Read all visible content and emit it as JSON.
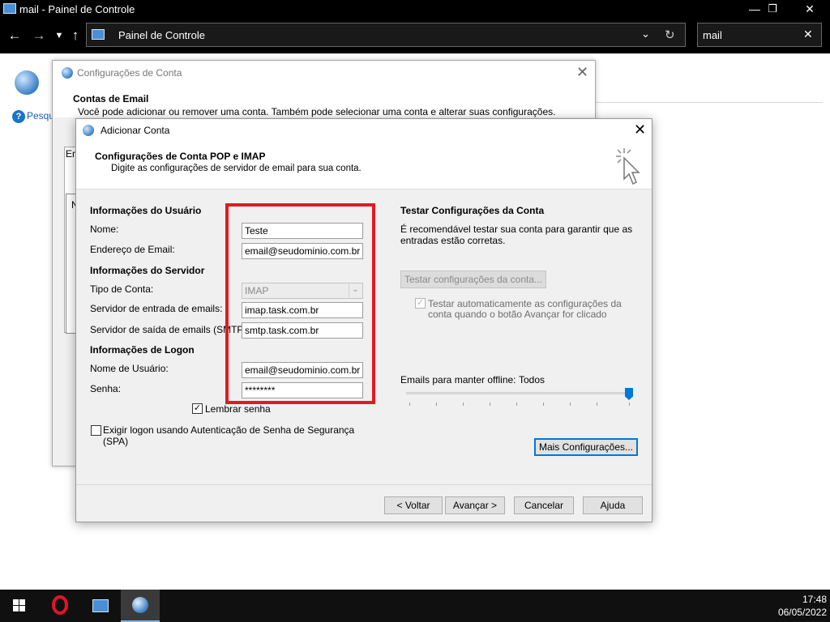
{
  "window": {
    "title": "mail - Painel de Controle",
    "address": "Painel de Controle",
    "search_value": "mail",
    "help_link": "Pesqu"
  },
  "account_settings": {
    "title": "Configurações de Conta",
    "heading": "Contas de Email",
    "description": "Você pode adicionar ou remover uma conta. Também pode selecionar uma conta e alterar suas configurações.",
    "tab_partial": "Em",
    "list_partial": "N"
  },
  "add_account": {
    "title": "Adicionar Conta",
    "heading": "Configurações de Conta POP e IMAP",
    "description": "Digite as configurações de servidor de email para sua conta.",
    "user_info": {
      "title": "Informações do Usuário",
      "name_label": "Nome:",
      "name_value": "Teste",
      "email_label": "Endereço de Email:",
      "email_value": "email@seudominio.com.br"
    },
    "server_info": {
      "title": "Informações do Servidor",
      "account_type_label": "Tipo de Conta:",
      "account_type_value": "IMAP",
      "incoming_label": "Servidor de entrada de emails:",
      "incoming_value": "imap.task.com.br",
      "outgoing_label": "Servidor de saída de emails (SMTP):",
      "outgoing_value": "smtp.task.com.br"
    },
    "logon_info": {
      "title": "Informações de Logon",
      "username_label": "Nome de Usuário:",
      "username_value": "email@seudominio.com.br",
      "password_label": "Senha:",
      "password_value": "********",
      "remember_label": "Lembrar senha",
      "remember_checked": true,
      "spa_label_line1": "Exigir logon usando Autenticação de Senha de Segurança",
      "spa_label_line2": "(SPA)",
      "spa_checked": false
    },
    "test": {
      "title": "Testar Configurações da Conta",
      "description_line1": "É recomendável testar sua conta para garantir que as",
      "description_line2": "entradas estão corretas.",
      "button": "Testar configurações da conta...",
      "auto_test_line1": "Testar automaticamente as configurações da",
      "auto_test_line2": "conta quando o botão Avançar for clicado",
      "auto_test_checked": true
    },
    "offline": {
      "label": "Emails para manter offline:",
      "value": "Todos",
      "slider_fraction": 1.0
    },
    "more_settings_button": "Mais Configurações...",
    "buttons": {
      "back": "< Voltar",
      "next": "Avançar >",
      "cancel": "Cancelar",
      "help": "Ajuda"
    }
  },
  "taskbar": {
    "time": "17:48",
    "date": "06/05/2022"
  },
  "colors": {
    "highlight": "#e01b24",
    "accent": "#0078d7"
  }
}
